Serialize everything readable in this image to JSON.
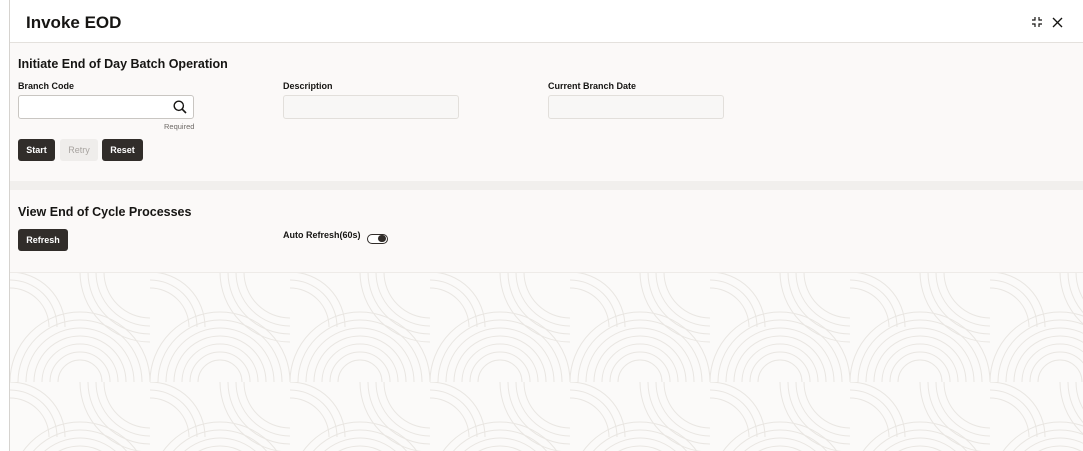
{
  "window": {
    "title": "Invoke EOD"
  },
  "batch_section": {
    "title": "Initiate End of Day Batch Operation",
    "branch_code": {
      "label": "Branch Code",
      "value": "",
      "helper": "Required"
    },
    "description": {
      "label": "Description",
      "value": ""
    },
    "current_branch_date": {
      "label": "Current Branch Date",
      "value": ""
    },
    "buttons": {
      "start": "Start",
      "retry": "Retry",
      "reset": "Reset"
    }
  },
  "cycle_section": {
    "title": "View End of Cycle Processes",
    "refresh_button": "Refresh",
    "auto_refresh_label": "Auto Refresh(60s)",
    "auto_refresh_enabled": false
  },
  "icons": {
    "minimize": "collapse-icon",
    "close": "close-icon",
    "search": "search-icon"
  },
  "colors": {
    "primary_button": "#312d2a",
    "panel_background": "#fbf9f8"
  }
}
